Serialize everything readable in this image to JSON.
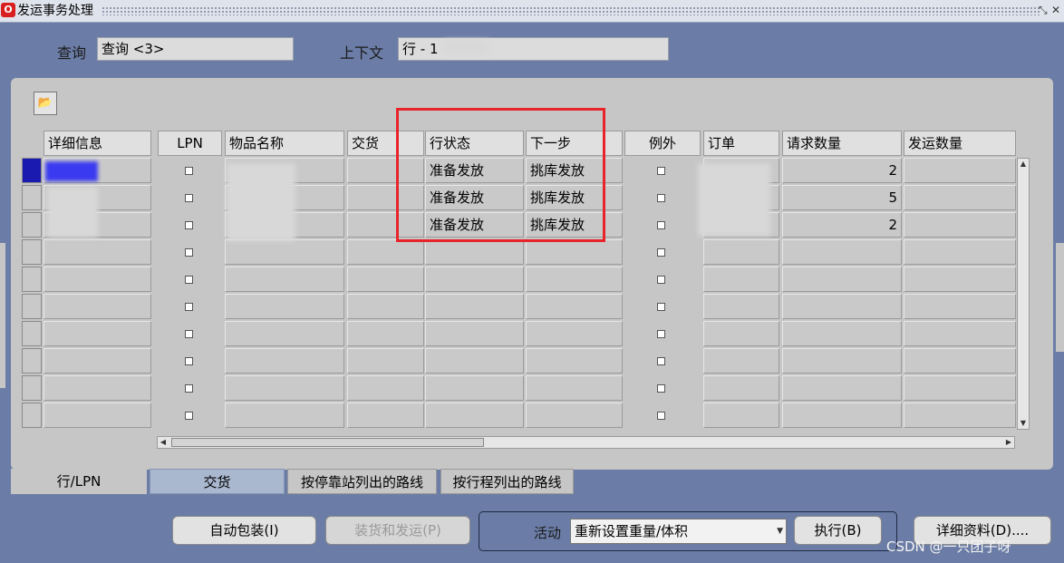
{
  "window": {
    "title": "发运事务处理",
    "icon_text": "O"
  },
  "query": {
    "label": "查询",
    "value": "查询 <3>"
  },
  "context": {
    "label": "上下文",
    "value": "行 - 1"
  },
  "columns": {
    "details": "详细信息",
    "lpn": "LPN",
    "item_name": "物品名称",
    "delivery": "交货",
    "line_status": "行状态",
    "next_step": "下一步",
    "exception": "例外",
    "order": "订单",
    "requested_qty": "请求数量",
    "shipped_qty": "发运数量"
  },
  "rows": [
    {
      "line_status": "准备发放",
      "next_step": "挑库发放",
      "requested_qty": "2"
    },
    {
      "line_status": "准备发放",
      "next_step": "挑库发放",
      "requested_qty": "5"
    },
    {
      "line_status": "准备发放",
      "next_step": "挑库发放",
      "requested_qty": "2"
    }
  ],
  "tabs": [
    "行/LPN",
    "交货",
    "按停靠站列出的路线",
    "按行程列出的路线"
  ],
  "buttons": {
    "auto_pack": "自动包装(I)",
    "ship_confirm": "装货和发运(P)",
    "execute": "执行(B)",
    "details": "详细资料(D)...."
  },
  "action": {
    "label": "活动",
    "value": "重新设置重量/体积"
  },
  "watermark": "CSDN @一只团子呀",
  "colors": {
    "highlight_box": "#e8232a",
    "background": "#6b7da6",
    "panel": "#c6c6c6"
  }
}
